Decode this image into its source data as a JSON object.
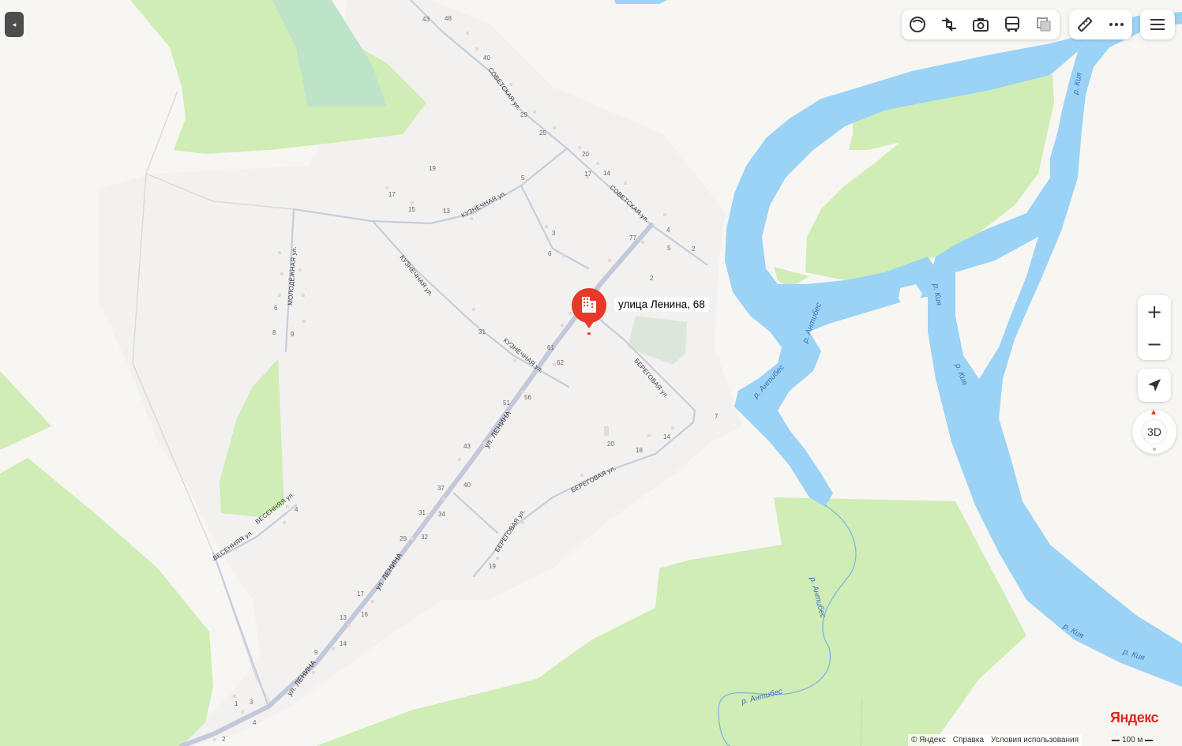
{
  "place": {
    "label": "улица Ленина, 68"
  },
  "streets": {
    "sovetskaya_1": "СОВЕТСКАЯ ул.",
    "sovetskaya_2": "СОВЕТСКАЯ ул.",
    "kuznechnaya_1": "КУЗНЕЧНАЯ ул.",
    "kuznechnaya_2": "КУЗНЕЧНАЯ ул.",
    "kuznechnaya_3": "КУЗНЕЧНАЯ ул.",
    "molodezhnaya": "МОЛОДЁЖНАЯ ул.",
    "lenina_1": "ул. ЛЕНИНА",
    "lenina_2": "ул. ЛЕНИНА",
    "lenina_3": "ул. ЛЕНИНА",
    "beregovaya_1": "БЕРЕГОВАЯ ул.",
    "beregovaya_2": "БЕРЕГОВАЯ ул.",
    "beregovaya_3": "БЕРЕГОВАЯ ул.",
    "vesennyaya_1": "ВЕСЕННЯЯ ул.",
    "vesennyaya_2": "ВЕСЕННЯЯ ул."
  },
  "rivers": {
    "kiya_1": "р. Кия",
    "kiya_2": "р. Кия",
    "kiya_3": "р. Кия",
    "kiya_4": "р. Кия",
    "kiya_5": "р. Кия",
    "antibes_1": "р. Антибес",
    "antibes_2": "р. Антибес",
    "antibes_3": "р. Антибес",
    "antibes_4": "р. Антибес"
  },
  "house_numbers": {
    "n43a": "43",
    "n48": "48",
    "n40a": "40",
    "n29a": "29",
    "n25": "25",
    "n20a": "20",
    "n17a": "17",
    "n14a": "14",
    "n19a": "19",
    "n17b": "17",
    "n15": "15",
    "n13a": "13",
    "n5a": "5",
    "n4a": "4",
    "n5b": "5",
    "n2a": "2",
    "n3a": "3",
    "n6a": "6",
    "n2b": "2",
    "n31a": "31",
    "n61": "61",
    "n62": "62",
    "n51": "51",
    "n56": "56",
    "n43b": "43",
    "n40b": "40",
    "n37": "37",
    "n34": "34",
    "n31b": "31",
    "n32": "32",
    "n29b": "29",
    "n17c": "17",
    "n16": "16",
    "n13b": "13",
    "n14b": "14",
    "n9a": "9",
    "n1": "1",
    "n3b": "3",
    "n4b": "4",
    "n2c": "2",
    "n6b": "6",
    "n8": "8",
    "n9b": "9",
    "n4c": "4",
    "n7": "7",
    "n14c": "14",
    "n18": "18",
    "n20b": "20",
    "n19b": "19",
    "n77": "77"
  },
  "controls": {
    "collapse_icon": "◂",
    "zoom_in": "+",
    "zoom_out": "−",
    "compass_label": "3D",
    "layer_icons": [
      "panorama-icon",
      "traffic-icon",
      "camera-icon",
      "bus-icon",
      "layers-icon"
    ],
    "tool_icons": [
      "ruler-icon",
      "more-icon"
    ],
    "menu_icon": "hamburger-menu-icon",
    "geolocation_icon": "geolocation-arrow-icon"
  },
  "footer": {
    "copyright": "© Яндекс",
    "help": "Справка",
    "terms": "Условия использования",
    "scale": "100 м"
  },
  "logo": {
    "text": "Яндекс"
  },
  "colors": {
    "water": "#9bd3f6",
    "forest": "#cfedb4",
    "land": "#f7f6f3",
    "settlement": "#efefed",
    "road_main": "#c3c9dc",
    "road_minor": "#c5cde0",
    "marker": "#e8382b"
  }
}
